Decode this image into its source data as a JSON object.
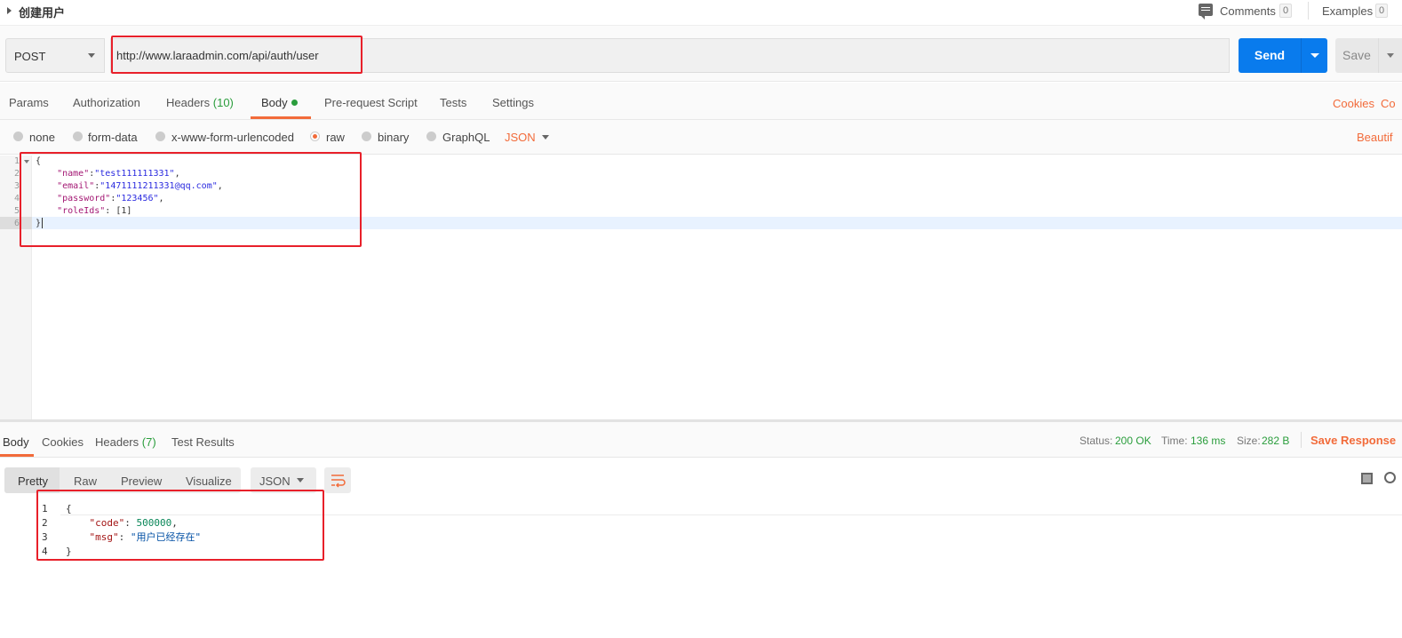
{
  "request": {
    "title": "创建用户",
    "comments_label": "Comments",
    "comments_count": "0",
    "examples_label": "Examples",
    "examples_count": "0"
  },
  "url_bar": {
    "method": "POST",
    "url": "http://www.laraadmin.com/api/auth/user",
    "send_label": "Send",
    "save_label": "Save"
  },
  "request_tabs": {
    "params": "Params",
    "authorization": "Authorization",
    "headers": "Headers",
    "headers_count": "(10)",
    "body": "Body",
    "pre_request": "Pre-request Script",
    "tests": "Tests",
    "settings": "Settings",
    "cookies_link": "Cookies",
    "code_link": "Co"
  },
  "body_types": {
    "options": [
      "none",
      "form-data",
      "x-www-form-urlencoded",
      "raw",
      "binary",
      "GraphQL"
    ],
    "selected": "raw",
    "format": "JSON",
    "beautify": "Beautif"
  },
  "request_body": {
    "line_numbers": [
      "1",
      "2",
      "3",
      "4",
      "5",
      "6"
    ],
    "open_brace": "{",
    "close_brace": "}",
    "fields": [
      {
        "key": "\"name\"",
        "sep": ":",
        "value": "\"test111111331\"",
        "tail": ","
      },
      {
        "key": "\"email\"",
        "sep": ":",
        "value": "\"1471111211331@qq.com\"",
        "tail": ","
      },
      {
        "key": "\"password\"",
        "sep": ":",
        "value": "\"123456\"",
        "tail": ","
      },
      {
        "key": "\"roleIds\"",
        "sep": ": ",
        "value": "[1]",
        "tail": ""
      }
    ]
  },
  "response_tabs": {
    "body": "Body",
    "cookies": "Cookies",
    "headers": "Headers",
    "headers_count": "(7)",
    "test_results": "Test Results"
  },
  "response_status": {
    "status_label": "Status:",
    "status_value": "200 OK",
    "time_label": "Time:",
    "time_value": "136 ms",
    "size_label": "Size:",
    "size_value": "282 B",
    "save_response": "Save Response"
  },
  "response_view": {
    "modes": [
      "Pretty",
      "Raw",
      "Preview",
      "Visualize"
    ],
    "selected_mode": "Pretty",
    "format": "JSON"
  },
  "response_body": {
    "line_numbers": [
      "1",
      "2",
      "3",
      "4"
    ],
    "open_brace": "{",
    "close_brace": "}",
    "code_key": "\"code\"",
    "code_value": "500000",
    "msg_key": "\"msg\"",
    "msg_value": "\"用户已经存在\""
  },
  "colors": {
    "accent": "#f26b3a",
    "send": "#097bed",
    "success": "#2a9d3c",
    "annotation": "#e8202a"
  }
}
